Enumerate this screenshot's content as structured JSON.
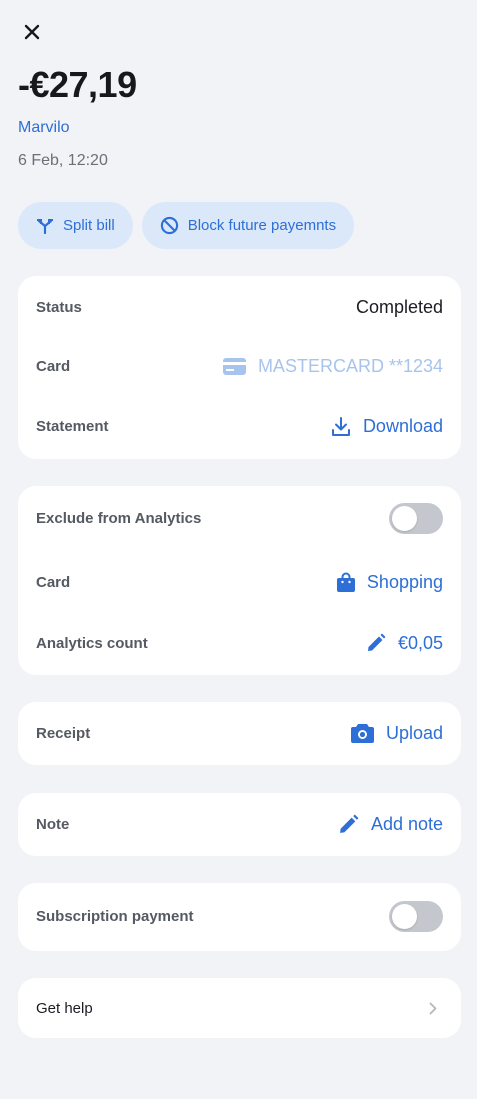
{
  "header": {
    "close_icon": "close-icon"
  },
  "transaction": {
    "amount": "-€27,19",
    "merchant": "Marvilo",
    "date": "6 Feb, 12:20"
  },
  "actions": {
    "split_bill": "Split bill",
    "block_future": "Block future payemnts"
  },
  "details": {
    "status_label": "Status",
    "status_value": "Completed",
    "card_label": "Card",
    "card_value": "MASTERCARD **1234",
    "statement_label": "Statement",
    "statement_value": "Download"
  },
  "analytics": {
    "exclude_label": "Exclude from Analytics",
    "exclude_on": false,
    "category_label": "Card",
    "category_value": "Shopping",
    "count_label": "Analytics count",
    "count_value": "€0,05"
  },
  "receipt": {
    "label": "Receipt",
    "action": "Upload"
  },
  "note": {
    "label": "Note",
    "action": "Add note"
  },
  "subscription": {
    "label": "Subscription payment",
    "on": false
  },
  "help": {
    "label": "Get help"
  },
  "colors": {
    "accent": "#2d6fd6",
    "pill_bg": "#dbe8f9",
    "page_bg": "#f2f3f6",
    "toggle_off": "#c4c7cd"
  }
}
